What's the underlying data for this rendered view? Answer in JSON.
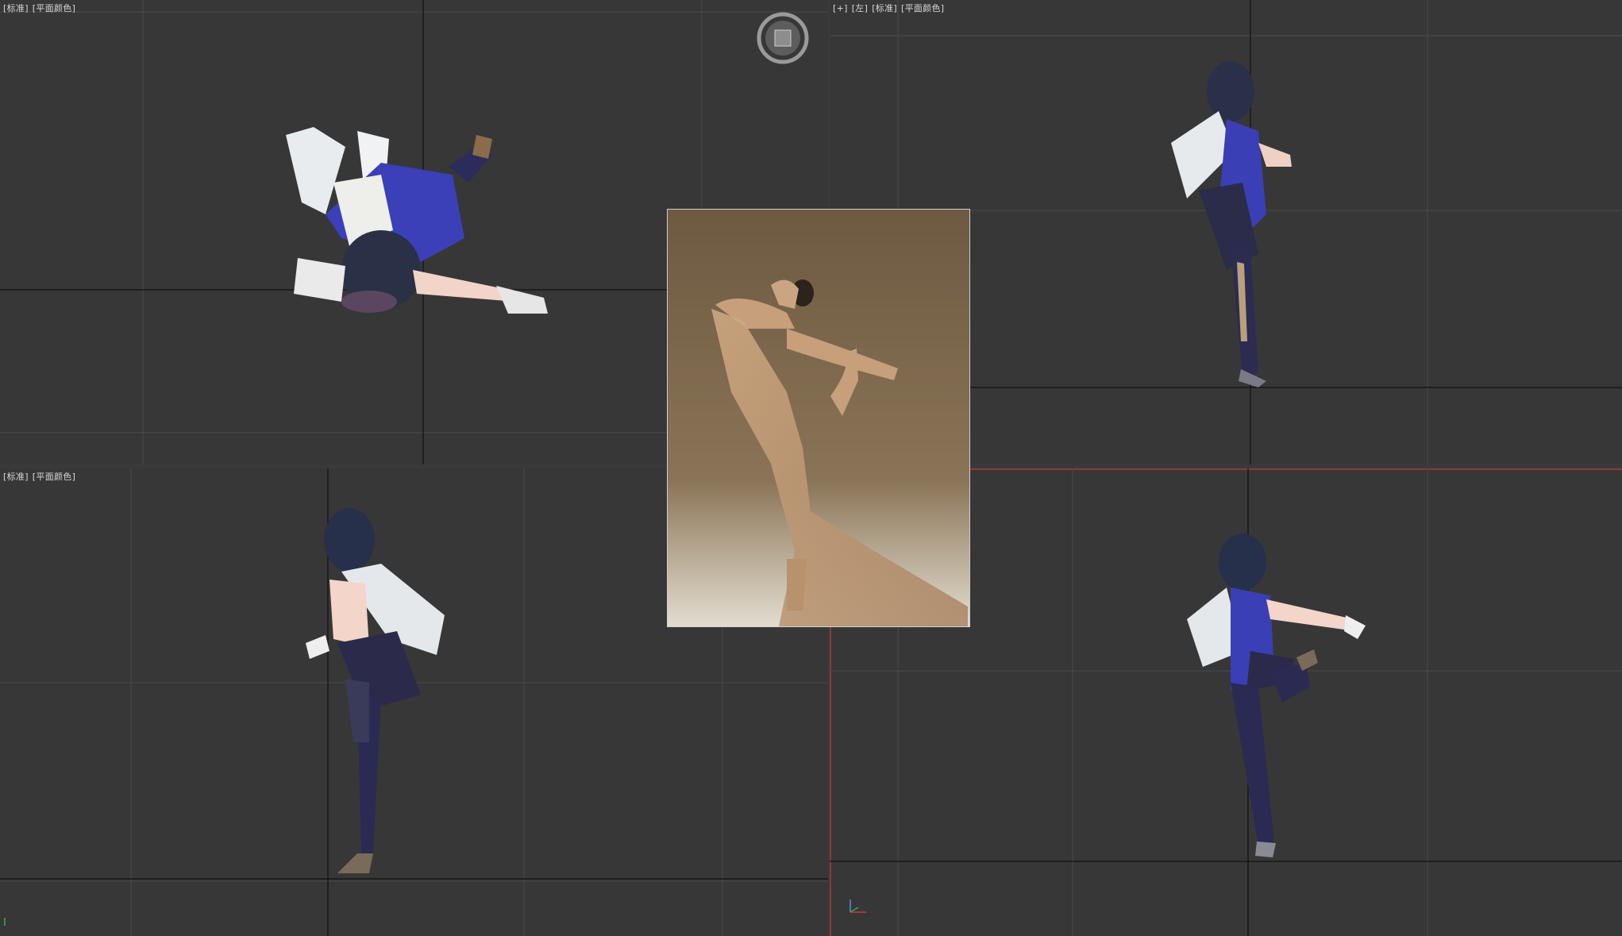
{
  "viewports": {
    "top": {
      "label_parts": [
        "[标准]",
        "[平面颜色]"
      ]
    },
    "left": {
      "label_parts": [
        "[+]",
        "[左]",
        "[标准]",
        "[平面颜色]"
      ]
    },
    "front": {
      "label_parts": [
        "[标准]",
        "[平面颜色]"
      ]
    },
    "perspective": {
      "label_parts": []
    }
  },
  "reference_image": {
    "subject": "dancer in sheer beige dress"
  },
  "model": {
    "subject": "anime character in blue outfit with white fur"
  },
  "colors": {
    "viewport_bg": "#373737",
    "grid": "#4a4a4a",
    "axis": "#0c0c0c",
    "active_border": "#8a3a3a"
  },
  "icons": {
    "viewcube": "viewcube-icon",
    "axis_tripod": "axis-tripod-icon"
  }
}
